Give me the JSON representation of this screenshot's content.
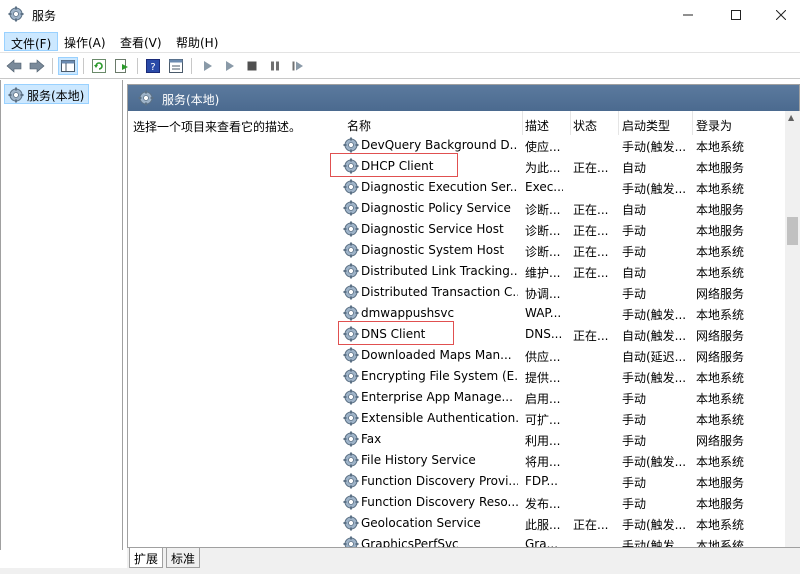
{
  "window": {
    "title": "服务"
  },
  "menu": [
    {
      "label": "文件(F)"
    },
    {
      "label": "操作(A)"
    },
    {
      "label": "查看(V)"
    },
    {
      "label": "帮助(H)"
    }
  ],
  "tree": {
    "selected": "服务(本地)"
  },
  "main": {
    "header": "服务(本地)",
    "description_hint": "选择一个项目来查看它的描述。",
    "columns": {
      "name": "名称",
      "desc": "描述",
      "status": "状态",
      "start": "启动类型",
      "logon": "登录为"
    },
    "rows": [
      {
        "name": "DevQuery Background D...",
        "desc": "使应...",
        "status": "",
        "start": "手动(触发...",
        "logon": "本地系统"
      },
      {
        "name": "DHCP Client",
        "desc": "为此...",
        "status": "正在...",
        "start": "自动",
        "logon": "本地服务"
      },
      {
        "name": "Diagnostic Execution Ser...",
        "desc": "Exec...",
        "status": "",
        "start": "手动(触发...",
        "logon": "本地系统"
      },
      {
        "name": "Diagnostic Policy Service",
        "desc": "诊断...",
        "status": "正在...",
        "start": "自动",
        "logon": "本地服务"
      },
      {
        "name": "Diagnostic Service Host",
        "desc": "诊断...",
        "status": "正在...",
        "start": "手动",
        "logon": "本地服务"
      },
      {
        "name": "Diagnostic System Host",
        "desc": "诊断...",
        "status": "正在...",
        "start": "手动",
        "logon": "本地系统"
      },
      {
        "name": "Distributed Link Tracking...",
        "desc": "维护...",
        "status": "正在...",
        "start": "自动",
        "logon": "本地系统"
      },
      {
        "name": "Distributed Transaction C...",
        "desc": "协调...",
        "status": "",
        "start": "手动",
        "logon": "网络服务"
      },
      {
        "name": "dmwappushsvc",
        "desc": "WAP...",
        "status": "",
        "start": "手动(触发...",
        "logon": "本地系统"
      },
      {
        "name": "DNS Client",
        "desc": "DNS...",
        "status": "正在...",
        "start": "自动(触发...",
        "logon": "网络服务"
      },
      {
        "name": "Downloaded Maps Man...",
        "desc": "供应...",
        "status": "",
        "start": "自动(延迟...",
        "logon": "网络服务"
      },
      {
        "name": "Encrypting File System (E...",
        "desc": "提供...",
        "status": "",
        "start": "手动(触发...",
        "logon": "本地系统"
      },
      {
        "name": "Enterprise App Manage...",
        "desc": "启用...",
        "status": "",
        "start": "手动",
        "logon": "本地系统"
      },
      {
        "name": "Extensible Authentication...",
        "desc": "可扩...",
        "status": "",
        "start": "手动",
        "logon": "本地系统"
      },
      {
        "name": "Fax",
        "desc": "利用...",
        "status": "",
        "start": "手动",
        "logon": "网络服务"
      },
      {
        "name": "File History Service",
        "desc": "将用...",
        "status": "",
        "start": "手动(触发...",
        "logon": "本地系统"
      },
      {
        "name": "Function Discovery Provi...",
        "desc": "FDP...",
        "status": "",
        "start": "手动",
        "logon": "本地服务"
      },
      {
        "name": "Function Discovery Reso...",
        "desc": "发布...",
        "status": "",
        "start": "手动",
        "logon": "本地服务"
      },
      {
        "name": "Geolocation Service",
        "desc": "此服...",
        "status": "正在...",
        "start": "手动(触发...",
        "logon": "本地系统"
      },
      {
        "name": "GraphicsPerfSvc",
        "desc": "Gra...",
        "status": "",
        "start": "手动(触发...",
        "logon": "本地系统"
      }
    ]
  },
  "tabs": [
    {
      "label": "扩展"
    },
    {
      "label": "标准"
    }
  ],
  "colors": {
    "highlight_box": "#e05050",
    "selection": "#cce8ff",
    "header_bg": "#5b7a9e"
  }
}
